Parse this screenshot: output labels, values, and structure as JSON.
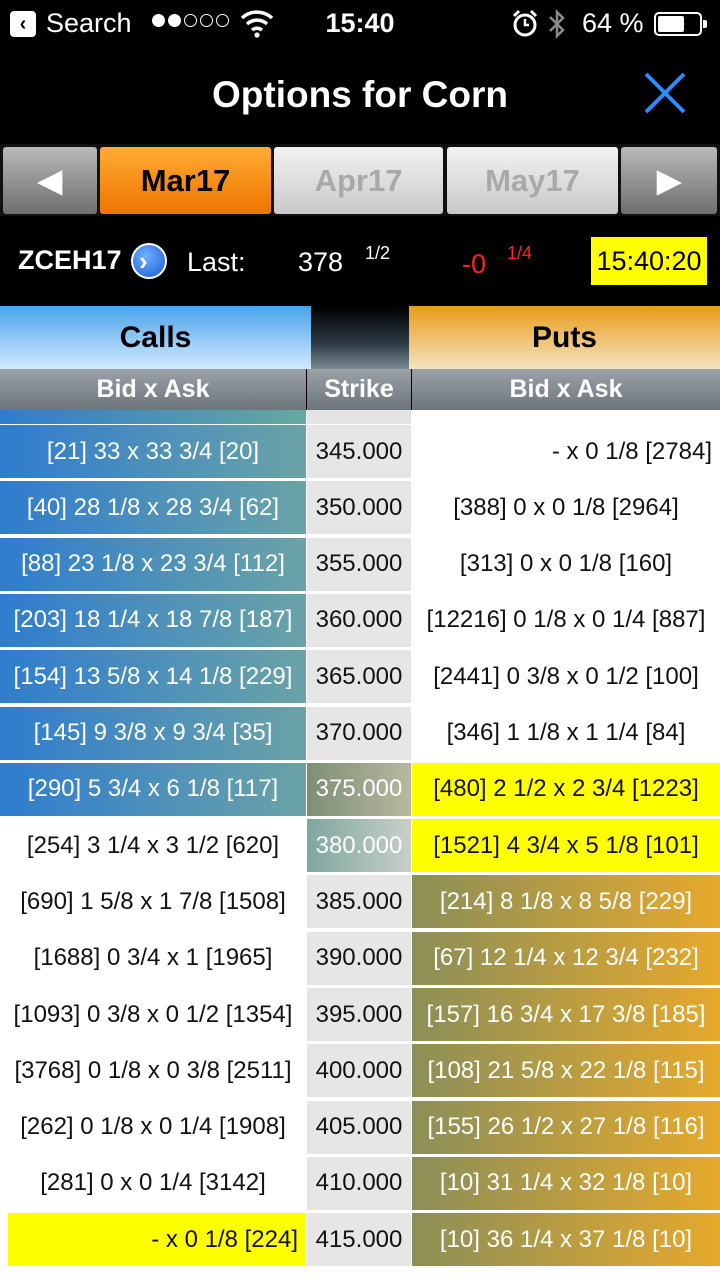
{
  "status_bar": {
    "back_app": "Search",
    "time": "15:40",
    "battery_pct": "64 %",
    "battery_level": 0.64,
    "signal_bars": [
      true,
      true,
      false,
      false,
      false
    ]
  },
  "header": {
    "title": "Options for Corn"
  },
  "months": {
    "prev_arrow": "◀",
    "next_arrow": "▶",
    "items": [
      "Mar17",
      "Apr17",
      "May17"
    ],
    "active": "Mar17"
  },
  "quote": {
    "symbol": "ZCEH17",
    "last_label": "Last:",
    "last_whole": "378",
    "last_frac": "1/2",
    "change_whole": "-0",
    "change_frac": "1/4",
    "time": "15:40:20"
  },
  "columns": {
    "calls": "Calls",
    "puts": "Puts",
    "calls_sub": "Bid x Ask",
    "strike": "Strike",
    "puts_sub": "Bid x Ask"
  },
  "rows": [
    {
      "call": "[21] 33 x 33 3/4 [20]",
      "strike": "345.000",
      "put": "- x 0 1/8 [2784]"
    },
    {
      "call": "[40] 28 1/8 x 28 3/4 [62]",
      "strike": "350.000",
      "put": "[388] 0 x 0 1/8 [2964]"
    },
    {
      "call": "[88] 23 1/8 x 23 3/4 [112]",
      "strike": "355.000",
      "put": "[313] 0 x 0 1/8 [160]"
    },
    {
      "call": "[203] 18 1/4 x 18 7/8 [187]",
      "strike": "360.000",
      "put": "[12216] 0 1/8 x 0 1/4 [887]"
    },
    {
      "call": "[154] 13 5/8 x 14 1/8 [229]",
      "strike": "365.000",
      "put": "[2441] 0 3/8 x 0 1/2 [100]"
    },
    {
      "call": "[145] 9 3/8 x 9 3/4 [35]",
      "strike": "370.000",
      "put": "[346] 1 1/8 x 1 1/4 [84]"
    },
    {
      "call": "[290] 5 3/4 x 6 1/8 [117]",
      "strike": "375.000",
      "put": "[480] 2 1/2 x 2 3/4 [1223]"
    },
    {
      "call": "[254] 3 1/4 x 3 1/2 [620]",
      "strike": "380.000",
      "put": "[1521] 4 3/4 x 5 1/8 [101]"
    },
    {
      "call": "[690] 1 5/8 x 1 7/8 [1508]",
      "strike": "385.000",
      "put": "[214] 8 1/8 x 8 5/8 [229]"
    },
    {
      "call": "[1688] 0 3/4 x 1 [1965]",
      "strike": "390.000",
      "put": "[67] 12 1/4 x 12 3/4 [232]"
    },
    {
      "call": "[1093] 0 3/8 x 0 1/2 [1354]",
      "strike": "395.000",
      "put": "[157] 16 3/4 x 17 3/8 [185]"
    },
    {
      "call": "[3768] 0 1/8 x 0 3/8 [2511]",
      "strike": "400.000",
      "put": "[108] 21 5/8 x 22 1/8 [115]"
    },
    {
      "call": "[262] 0 1/8 x 0 1/4 [1908]",
      "strike": "405.000",
      "put": "[155] 26 1/2 x 27 1/8 [116]"
    },
    {
      "call": "[281] 0 x 0 1/4 [3142]",
      "strike": "410.000",
      "put": "[10] 31 1/4 x 32 1/8 [10]"
    },
    {
      "call": "- x 0 1/8 [224]",
      "strike": "415.000",
      "put": "[10] 36 1/4 x 37 1/8 [10]"
    }
  ]
}
